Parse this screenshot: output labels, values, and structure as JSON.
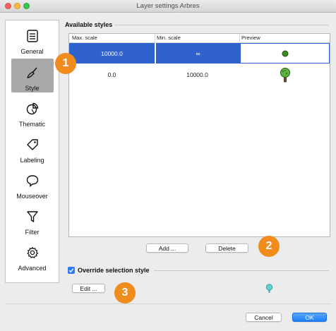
{
  "window": {
    "title": "Layer settings Arbres"
  },
  "sidebar": {
    "items": [
      {
        "label": "General",
        "icon": "list-icon"
      },
      {
        "label": "Style",
        "icon": "brush-icon",
        "selected": true
      },
      {
        "label": "Thematic",
        "icon": "pie-chart-icon"
      },
      {
        "label": "Labeling",
        "icon": "tag-icon"
      },
      {
        "label": "Mouseover",
        "icon": "speech-bubble-icon"
      },
      {
        "label": "Filter",
        "icon": "funnel-icon"
      },
      {
        "label": "Advanced",
        "icon": "gear-icon"
      }
    ]
  },
  "badges": [
    "1",
    "2",
    "3"
  ],
  "styles": {
    "section_title": "Available styles",
    "columns": [
      "Max. scale",
      "Min. scale",
      "Preview"
    ],
    "rows": [
      {
        "max_scale": "10000.0",
        "min_scale": "∞",
        "preview": "green-dot-icon",
        "selected": true
      },
      {
        "max_scale": "0.0",
        "min_scale": "10000.0",
        "preview": "tree-icon",
        "selected": false
      }
    ],
    "add_label": "Add ...",
    "delete_label": "Delete"
  },
  "override": {
    "label": "Override selection style",
    "checked": true,
    "edit_label": "Edit ...",
    "preview": "small-tree-icon"
  },
  "footer": {
    "cancel_label": "Cancel",
    "ok_label": "OK"
  },
  "colors": {
    "selection": "#2f62cc",
    "badge": "#f08c1d",
    "accent": "#2d7cf6"
  }
}
